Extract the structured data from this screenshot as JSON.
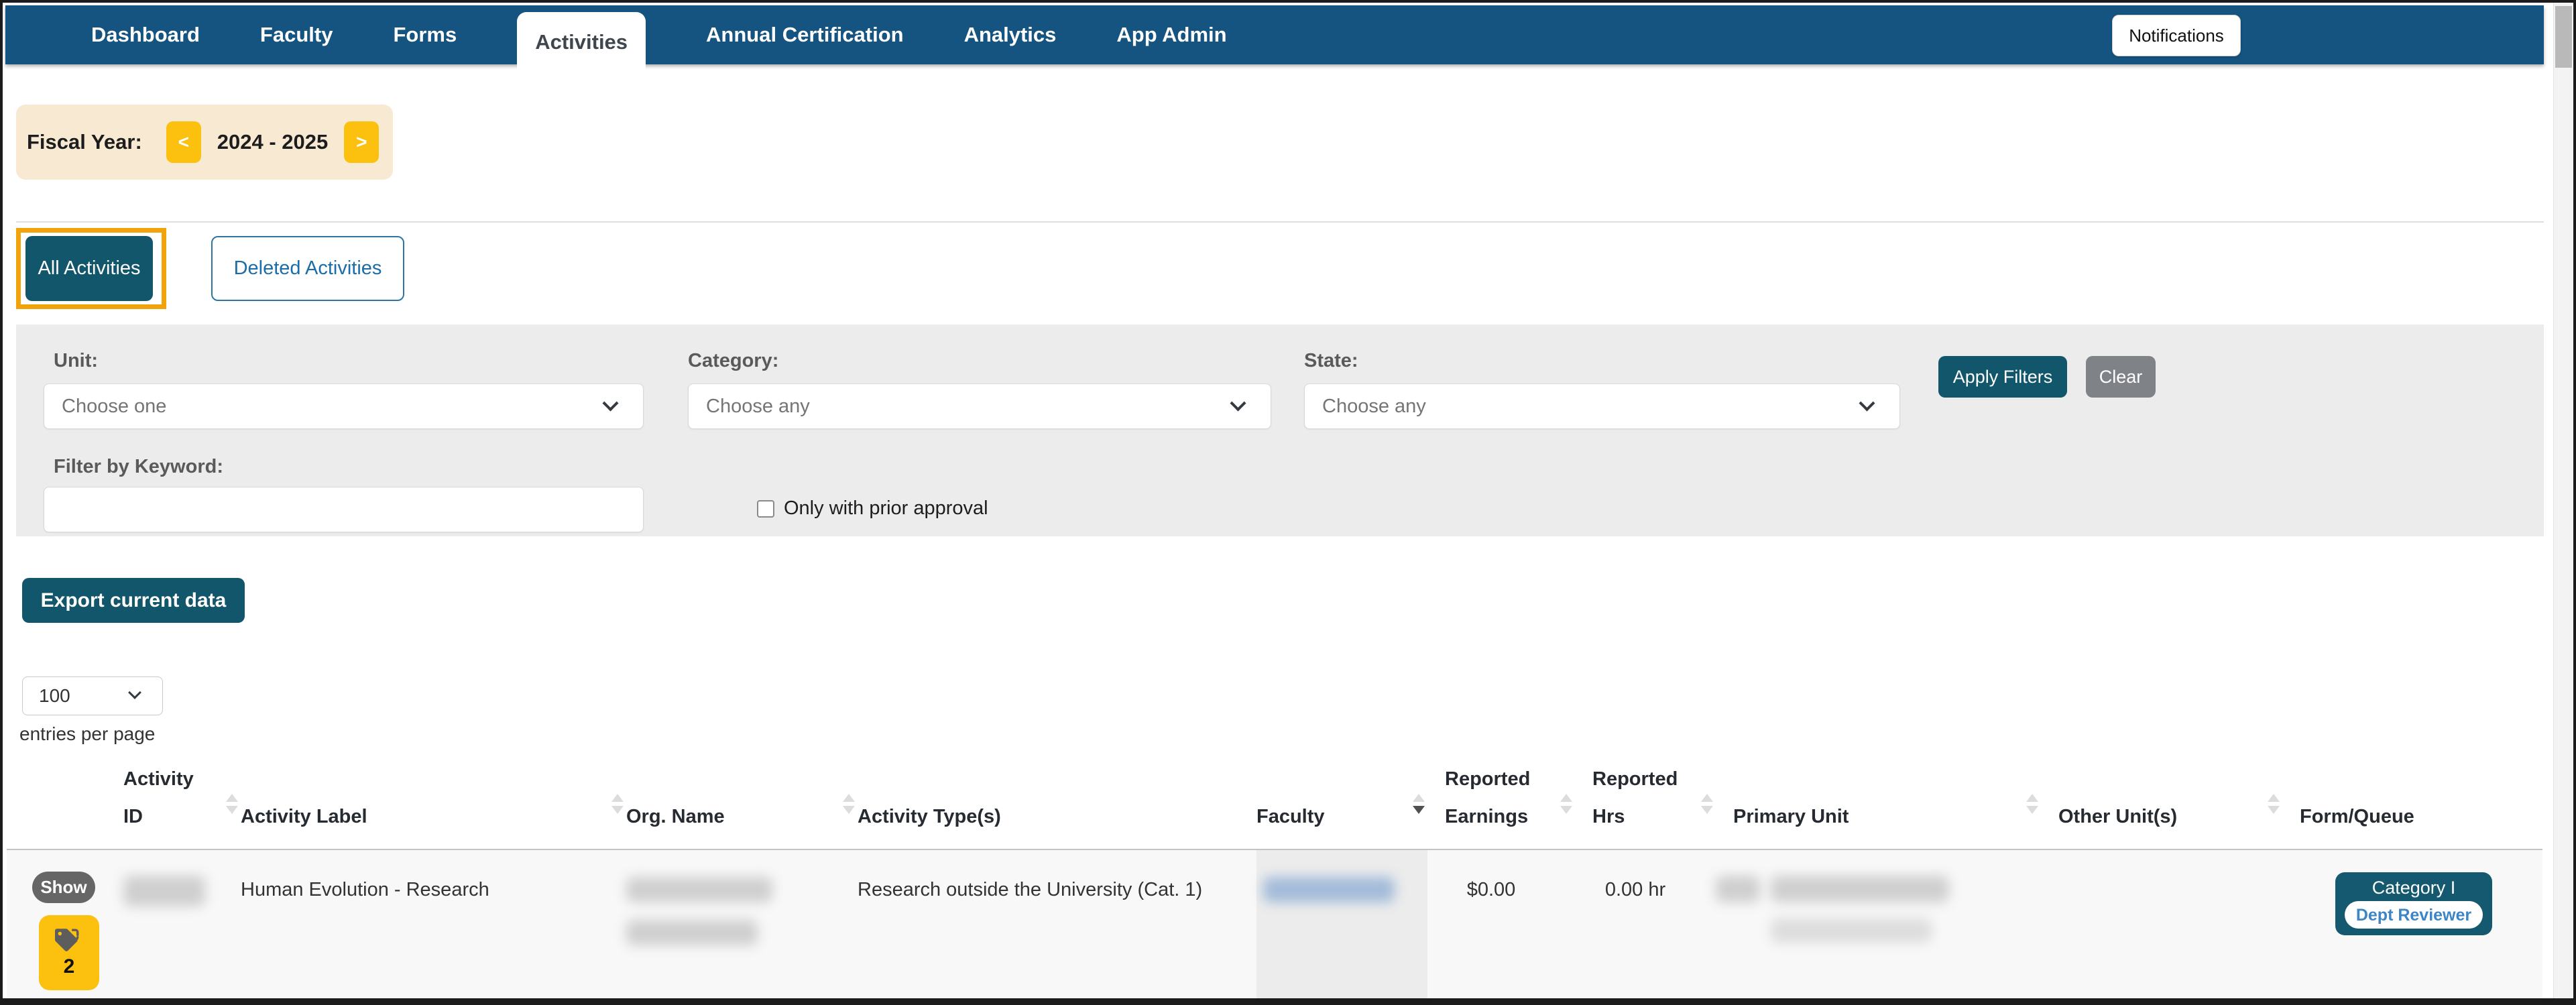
{
  "nav": {
    "tabs": [
      {
        "label": "Dashboard"
      },
      {
        "label": "Faculty"
      },
      {
        "label": "Forms"
      },
      {
        "label": "Activities"
      },
      {
        "label": "Annual Certification"
      },
      {
        "label": "Analytics"
      },
      {
        "label": "App Admin"
      }
    ],
    "active_tab": "Activities",
    "notifications_label": "Notifications"
  },
  "fiscal_year": {
    "label": "Fiscal Year:",
    "value": "2024 - 2025",
    "prev_label": "<",
    "next_label": ">"
  },
  "view_tabs": {
    "all_label": "All Activities",
    "deleted_label": "Deleted Activities"
  },
  "filters": {
    "unit_label": "Unit:",
    "unit_value": "Choose one",
    "category_label": "Category:",
    "category_value": "Choose any",
    "state_label": "State:",
    "state_value": "Choose any",
    "keyword_label": "Filter by Keyword:",
    "keyword_value": "",
    "prior_approval_label": "Only with prior approval",
    "apply_label": "Apply Filters",
    "clear_label": "Clear"
  },
  "export_label": "Export current data",
  "pagination": {
    "page_size": "100",
    "entries_label": "entries per page"
  },
  "table": {
    "columns": [
      {
        "label": "",
        "sort": "none"
      },
      {
        "label": "Activity ID",
        "sort": "both"
      },
      {
        "label": "Activity Label",
        "sort": "both"
      },
      {
        "label": "Org. Name",
        "sort": "both"
      },
      {
        "label": "Activity Type(s)",
        "sort": "none"
      },
      {
        "label": "Faculty",
        "sort": "desc"
      },
      {
        "label": "Reported Earnings",
        "sort": "both"
      },
      {
        "label": "Reported Hrs",
        "sort": "both"
      },
      {
        "label": "Primary Unit",
        "sort": "both"
      },
      {
        "label": "Other Unit(s)",
        "sort": "both"
      },
      {
        "label": "Form/Queue",
        "sort": "none"
      }
    ],
    "row": {
      "show_label": "Show",
      "attachment_count": "2",
      "activity_label": "Human Evolution - Research",
      "activity_types": "Research outside the University (Cat. 1)",
      "reported_earnings": "$0.00",
      "reported_hrs": "0.00 hr",
      "form_queue": {
        "category": "Category I",
        "queue": "Dept Reviewer"
      },
      "redactions": {
        "activity_id": true,
        "org_name": true,
        "faculty": true,
        "primary_unit": true
      }
    }
  },
  "colors": {
    "nav_blue": "#155480",
    "button_teal": "#12566b",
    "accent_yellow": "#fcc10e",
    "highlight_orange": "#f0a30a",
    "fiscal_cream": "#f8e9d2",
    "panel_gray": "#ececec",
    "clear_gray": "#7f8387",
    "queue_link_blue": "#3d85c6"
  }
}
